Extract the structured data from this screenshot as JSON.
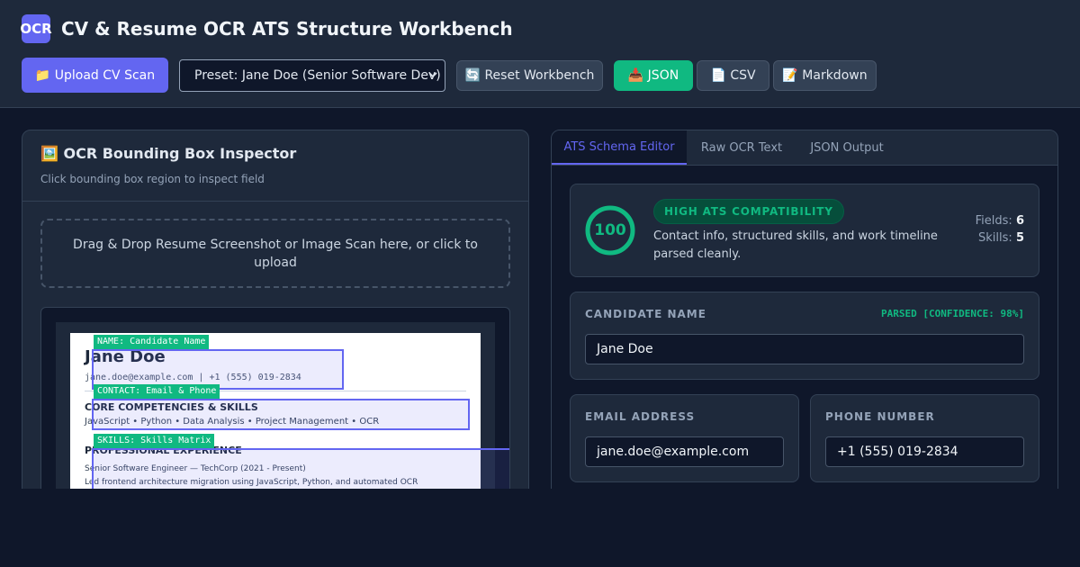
{
  "header": {
    "logo_text": "OCR",
    "title": "CV & Resume OCR ATS Structure Workbench"
  },
  "toolbar": {
    "upload_label": "📁 Upload CV Scan",
    "preset_value": "Preset: Jane Doe (Senior Software Dev)",
    "reset_label": "🔄 Reset Workbench",
    "json_label": "📥 JSON",
    "csv_label": "📄 CSV",
    "markdown_label": "📝 Markdown"
  },
  "inspector": {
    "title": "🖼️ OCR Bounding Box Inspector",
    "subtitle": "Click bounding box region to inspect field",
    "dropzone_text": "Drag & Drop Resume Screenshot or Image Scan here, or click to upload"
  },
  "resume": {
    "name": "Jane Doe",
    "contact": "jane.doe@example.com  |  +1 (555) 019-2834",
    "skills_heading": "CORE COMPETENCIES & SKILLS",
    "skills_line": "JavaScript  •  Python  •  Data Analysis  •  Project Management  •  OCR",
    "experience_heading": "PROFESSIONAL EXPERIENCE",
    "job_title": "Senior Software Engineer — TechCorp (2021 - Present)",
    "job_desc": "Led frontend architecture migration using JavaScript, Python, and automated OCR"
  },
  "bboxes": [
    {
      "tag": "NAME: Candidate Name"
    },
    {
      "tag": "CONTACT: Email & Phone"
    },
    {
      "tag": "SKILLS: Skills Matrix"
    }
  ],
  "tabs": [
    {
      "label": "ATS Schema Editor",
      "active": true
    },
    {
      "label": "Raw OCR Text",
      "active": false
    },
    {
      "label": "JSON Output",
      "active": false
    }
  ],
  "score": {
    "value": "100",
    "badge": "HIGH ATS COMPATIBILITY",
    "description": "Contact info, structured skills, and work timeline parsed cleanly.",
    "fields_label": "Fields:",
    "fields_value": "6",
    "skills_label": "Skills:",
    "skills_value": "5"
  },
  "fields": {
    "name_label": "CANDIDATE NAME",
    "name_confidence": "PARSED [CONFIDENCE: 98%]",
    "name_value": "Jane Doe",
    "email_label": "EMAIL ADDRESS",
    "email_value": "jane.doe@example.com",
    "phone_label": "PHONE NUMBER",
    "phone_value": "+1 (555) 019-2834"
  },
  "colors": {
    "accent": "#6366f1",
    "success": "#10b981",
    "background": "#0f172a",
    "panel": "#1e293b"
  }
}
